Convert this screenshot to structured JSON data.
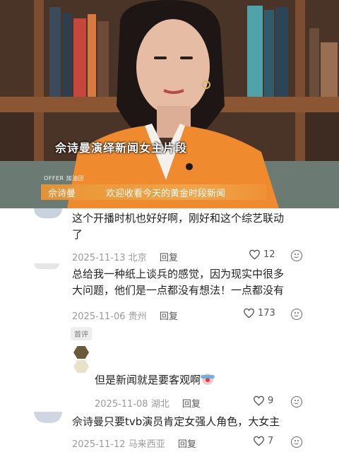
{
  "video": {
    "caption_main": "佘诗曼演绎新闻女主片段",
    "offer_tag": "OFFER 加油团",
    "name_tag": "佘诗曼",
    "subtitle": "欢迎收看今天的黄金时段新闻"
  },
  "comments": [
    {
      "text_line1": "这个开播时机也好好啊，刚好和这个综艺联动",
      "text_line2": "了",
      "date": "2025-11-13",
      "location": "北京",
      "reply_label": "回复",
      "likes": "12"
    },
    {
      "text_line1": "总给我一种纸上谈兵的感觉，因为现实中很多",
      "text_line2": "大问题，他们是一点都没有想法！一点都没有",
      "date": "2025-11-06",
      "location": "贵州",
      "reply_label": "回复",
      "likes": "173",
      "badge": "首评"
    },
    {
      "text_line1": "但是新闻就是要客观啊",
      "date": "2025-11-08",
      "location": "湖北",
      "reply_label": "回复",
      "likes": "9"
    },
    {
      "text_line1": "佘诗曼只要tvb演员肯定女强人角色，大女主",
      "date": "2025-11-12",
      "location": "马来西亚",
      "reply_label": "回复",
      "likes": "7"
    }
  ],
  "colors": {
    "accent_orange": "#e8913a",
    "meta_gray": "#9a9a9a",
    "text_dark": "#222222"
  }
}
